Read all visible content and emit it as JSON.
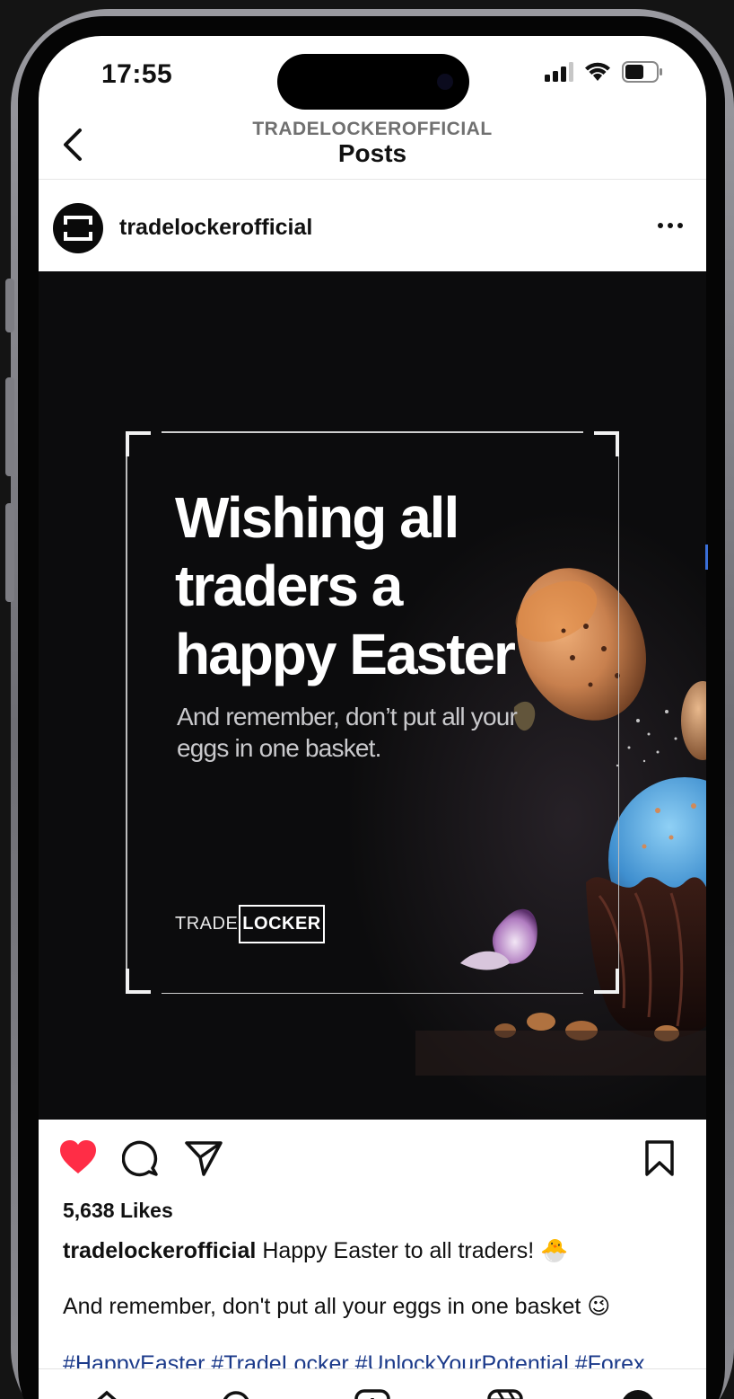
{
  "status_bar": {
    "time": "17:55"
  },
  "header": {
    "account": "TRADELOCKEROFFICIAL",
    "title": "Posts"
  },
  "post": {
    "author": "tradelockerofficial",
    "image": {
      "headline_lines": [
        "Wishing all",
        "traders a",
        "happy Easter"
      ],
      "subtitle_lines": [
        "And remember, don’t put all your",
        "eggs in one basket."
      ],
      "brand_trade": "TRADE",
      "brand_locker": "LOCKER"
    },
    "likes": "5,638 Likes",
    "caption_author": "tradelockerofficial",
    "caption_text": "Happy Easter to all traders! 🐣",
    "caption_line2": "And remember, don't put all your eggs in one basket 😉",
    "hashtags": "#HappyEaster #TradeLocker #UnlockYourPotential #Forex",
    "liked": true
  },
  "colors": {
    "like": "#ff2d46",
    "hashtag": "#1b3a8a",
    "image_bg": "#0c0c0d"
  },
  "icons": [
    "back-icon",
    "more-icon",
    "heart-icon",
    "comment-icon",
    "share-icon",
    "bookmark-icon",
    "home-icon",
    "search-icon",
    "create-icon",
    "reels-icon",
    "profile-icon"
  ]
}
